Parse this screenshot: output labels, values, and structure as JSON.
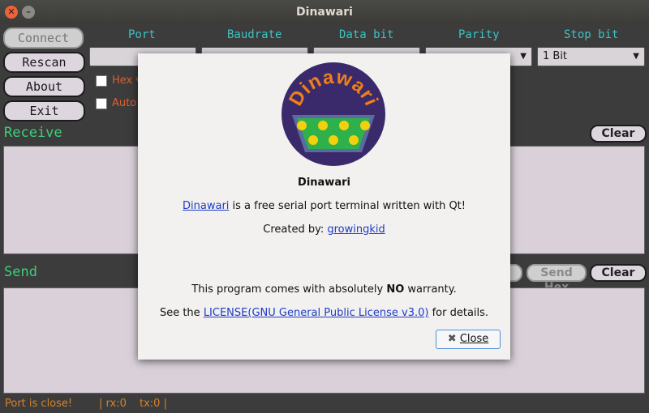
{
  "window": {
    "title": "Dinawari",
    "close_glyph": "✕",
    "min_glyph": "–"
  },
  "buttons": {
    "connect": "Connect",
    "rescan": "Rescan",
    "about": "About",
    "exit": "Exit"
  },
  "columns": {
    "port": "Port",
    "baudrate": "Baudrate",
    "data_bit": "Data bit",
    "parity": "Parity",
    "stop_bit": "Stop bit"
  },
  "combos": {
    "stop_bit_value": "1 Bit"
  },
  "options": {
    "hex_label": "Hex v",
    "auto_label": "Auto"
  },
  "receive": {
    "label": "Receive",
    "clear": "Clear"
  },
  "send": {
    "label": "Send",
    "send_hex": "Send Hex",
    "clear": "Clear"
  },
  "status": {
    "port": "Port is close!",
    "rx": "| rx:0",
    "tx": "tx:0 |"
  },
  "about_dialog": {
    "logo_text": "Dinawari",
    "name": "Dinawari",
    "desc_link": "Dinawari",
    "desc_rest": " is a free serial port terminal written with Qt!",
    "created_by": "Created by: ",
    "author_link": "growingkid",
    "warranty_pre": "This program comes with absolutely ",
    "warranty_bold": "NO",
    "warranty_post": " warranty.",
    "license_pre": "See the ",
    "license_link": "LICENSE(GNU General Public License v3.0)",
    "license_post": " for details.",
    "close_label": "Close",
    "close_icon": "✖"
  },
  "colors": {
    "accent_cyan": "#3cc4c4",
    "accent_green": "#3cd07a",
    "accent_orange": "#e55d2e",
    "logo_circle": "#3a2a6b",
    "logo_text": "#ef7f1a",
    "logo_connector": "#2eb04a",
    "logo_pins": "#f2d00c"
  }
}
